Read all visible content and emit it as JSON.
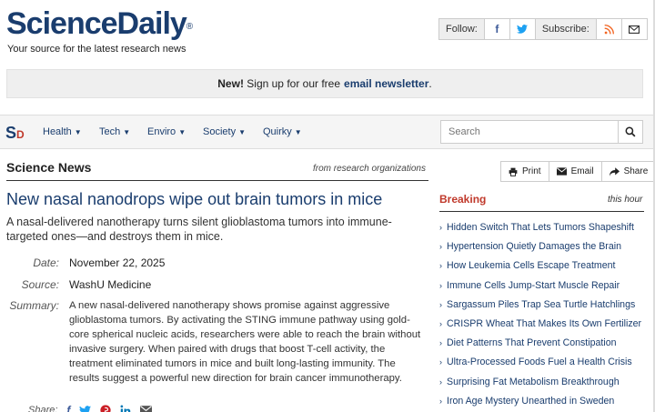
{
  "site": {
    "logo": "ScienceDaily",
    "logo_mark": "®",
    "tagline": "Your source for the latest research news"
  },
  "follow": {
    "follow_label": "Follow:",
    "subscribe_label": "Subscribe:",
    "facebook_glyph": "f",
    "twitter_glyph": "🐦",
    "rss_glyph": "))",
    "email_glyph": "✉"
  },
  "newsletter": {
    "prefix": "New!",
    "text": "Sign up for our free",
    "link": "email newsletter",
    "suffix": "."
  },
  "nav": {
    "brand_s": "S",
    "brand_d": "D",
    "items": [
      {
        "label": "Health",
        "caret": "▼"
      },
      {
        "label": "Tech",
        "caret": "▼"
      },
      {
        "label": "Enviro",
        "caret": "▼"
      },
      {
        "label": "Society",
        "caret": "▼"
      },
      {
        "label": "Quirky",
        "caret": "▼"
      }
    ],
    "search_placeholder": "Search"
  },
  "section": {
    "title": "Science News",
    "from": "from research organizations"
  },
  "share_tools": [
    {
      "label": "Print",
      "icon": "🖶"
    },
    {
      "label": "Email",
      "icon": "✉"
    },
    {
      "label": "Share",
      "icon": "➦"
    }
  ],
  "article": {
    "headline": "New nasal nanodrops wipe out brain tumors in mice",
    "dek": "A nasal-delivered nanotherapy turns silent glioblastoma tumors into immune-targeted ones—and destroys them in mice.",
    "date_label": "Date:",
    "date": "November 22, 2025",
    "source_label": "Source:",
    "source": "WashU Medicine",
    "summary_label": "Summary:",
    "summary": "A new nasal-delivered nanotherapy shows promise against aggressive glioblastoma tumors. By activating the STING immune pathway using gold-core spherical nucleic acids, researchers were able to reach the brain without invasive surgery. When paired with drugs that boost T-cell activity, the treatment eliminated tumors in mice and built long-lasting immunity. The results suggest a powerful new direction for brain cancer immunotherapy.",
    "share_label": "Share:"
  },
  "breaking": {
    "title": "Breaking",
    "subtitle": "this hour",
    "chevron": "›",
    "items": [
      "Hidden Switch That Lets Tumors Shapeshift",
      "Hypertension Quietly Damages the Brain",
      "How Leukemia Cells Escape Treatment",
      "Immune Cells Jump-Start Muscle Repair",
      "Sargassum Piles Trap Sea Turtle Hatchlings",
      "CRISPR Wheat That Makes Its Own Fertilizer",
      "Diet Patterns That Prevent Constipation",
      "Ultra-Processed Foods Fuel a Health Crisis",
      "Surprising Fat Metabolism Breakthrough",
      "Iron Age Mystery Unearthed in Sweden"
    ]
  },
  "colors": {
    "brand_blue": "#1a3d6e",
    "breaking_red": "#c0392b",
    "facebook": "#3b5998",
    "twitter": "#1da1f2",
    "rss": "#f26522",
    "pinterest": "#cb2027",
    "linkedin": "#0077b5"
  }
}
